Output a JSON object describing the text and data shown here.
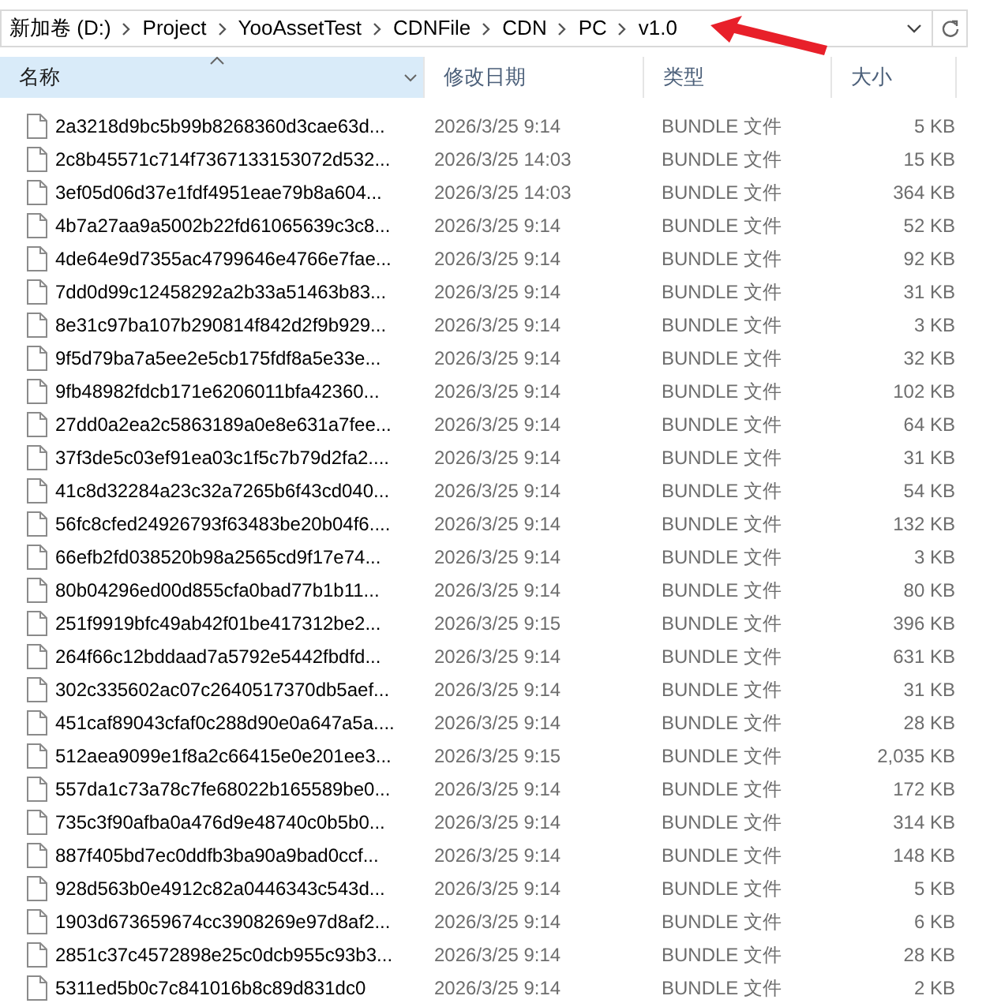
{
  "address_bar": {
    "crumbs": [
      "新加卷 (D:)",
      "Project",
      "YooAssetTest",
      "CDNFile",
      "CDN",
      "PC",
      "v1.0"
    ]
  },
  "annotation": {
    "kind": "arrow"
  },
  "columns": [
    {
      "label": "名称",
      "sorted": true
    },
    {
      "label": "修改日期",
      "sorted": false
    },
    {
      "label": "类型",
      "sorted": false
    },
    {
      "label": "大小",
      "sorted": false
    }
  ],
  "files": [
    {
      "name": "2a3218d9bc5b99b8268360d3cae63d...",
      "modified": "2026/3/25 9:14",
      "type": "BUNDLE 文件",
      "size": "5 KB"
    },
    {
      "name": "2c8b45571c714f7367133153072d532...",
      "modified": "2026/3/25 14:03",
      "type": "BUNDLE 文件",
      "size": "15 KB"
    },
    {
      "name": "3ef05d06d37e1fdf4951eae79b8a604...",
      "modified": "2026/3/25 14:03",
      "type": "BUNDLE 文件",
      "size": "364 KB"
    },
    {
      "name": "4b7a27aa9a5002b22fd61065639c3c8...",
      "modified": "2026/3/25 9:14",
      "type": "BUNDLE 文件",
      "size": "52 KB"
    },
    {
      "name": "4de64e9d7355ac4799646e4766e7fae...",
      "modified": "2026/3/25 9:14",
      "type": "BUNDLE 文件",
      "size": "92 KB"
    },
    {
      "name": "7dd0d99c12458292a2b33a51463b83...",
      "modified": "2026/3/25 9:14",
      "type": "BUNDLE 文件",
      "size": "31 KB"
    },
    {
      "name": "8e31c97ba107b290814f842d2f9b929...",
      "modified": "2026/3/25 9:14",
      "type": "BUNDLE 文件",
      "size": "3 KB"
    },
    {
      "name": "9f5d79ba7a5ee2e5cb175fdf8a5e33e...",
      "modified": "2026/3/25 9:14",
      "type": "BUNDLE 文件",
      "size": "32 KB"
    },
    {
      "name": "9fb48982fdcb171e6206011bfa42360...",
      "modified": "2026/3/25 9:14",
      "type": "BUNDLE 文件",
      "size": "102 KB"
    },
    {
      "name": "27dd0a2ea2c5863189a0e8e631a7fee...",
      "modified": "2026/3/25 9:14",
      "type": "BUNDLE 文件",
      "size": "64 KB"
    },
    {
      "name": "37f3de5c03ef91ea03c1f5c7b79d2fa2....",
      "modified": "2026/3/25 9:14",
      "type": "BUNDLE 文件",
      "size": "31 KB"
    },
    {
      "name": "41c8d32284a23c32a7265b6f43cd040...",
      "modified": "2026/3/25 9:14",
      "type": "BUNDLE 文件",
      "size": "54 KB"
    },
    {
      "name": "56fc8cfed24926793f63483be20b04f6....",
      "modified": "2026/3/25 9:14",
      "type": "BUNDLE 文件",
      "size": "132 KB"
    },
    {
      "name": "66efb2fd038520b98a2565cd9f17e74...",
      "modified": "2026/3/25 9:14",
      "type": "BUNDLE 文件",
      "size": "3 KB"
    },
    {
      "name": "80b04296ed00d855cfa0bad77b1b11...",
      "modified": "2026/3/25 9:14",
      "type": "BUNDLE 文件",
      "size": "80 KB"
    },
    {
      "name": "251f9919bfc49ab42f01be417312be2...",
      "modified": "2026/3/25 9:15",
      "type": "BUNDLE 文件",
      "size": "396 KB"
    },
    {
      "name": "264f66c12bddaad7a5792e5442fbdfd...",
      "modified": "2026/3/25 9:14",
      "type": "BUNDLE 文件",
      "size": "631 KB"
    },
    {
      "name": "302c335602ac07c2640517370db5aef...",
      "modified": "2026/3/25 9:14",
      "type": "BUNDLE 文件",
      "size": "31 KB"
    },
    {
      "name": "451caf89043cfaf0c288d90e0a647a5a....",
      "modified": "2026/3/25 9:14",
      "type": "BUNDLE 文件",
      "size": "28 KB"
    },
    {
      "name": "512aea9099e1f8a2c66415e0e201ee3...",
      "modified": "2026/3/25 9:15",
      "type": "BUNDLE 文件",
      "size": "2,035 KB"
    },
    {
      "name": "557da1c73a78c7fe68022b165589be0...",
      "modified": "2026/3/25 9:14",
      "type": "BUNDLE 文件",
      "size": "172 KB"
    },
    {
      "name": "735c3f90afba0a476d9e48740c0b5b0...",
      "modified": "2026/3/25 9:14",
      "type": "BUNDLE 文件",
      "size": "314 KB"
    },
    {
      "name": "887f405bd7ec0ddfb3ba90a9bad0ccf...",
      "modified": "2026/3/25 9:14",
      "type": "BUNDLE 文件",
      "size": "148 KB"
    },
    {
      "name": "928d563b0e4912c82a0446343c543d...",
      "modified": "2026/3/25 9:14",
      "type": "BUNDLE 文件",
      "size": "5 KB"
    },
    {
      "name": "1903d673659674cc3908269e97d8af2...",
      "modified": "2026/3/25 9:14",
      "type": "BUNDLE 文件",
      "size": "6 KB"
    },
    {
      "name": "2851c37c4572898e25c0dcb955c93b3...",
      "modified": "2026/3/25 9:14",
      "type": "BUNDLE 文件",
      "size": "28 KB"
    },
    {
      "name": "5311ed5b0c7c841016b8c89d831dc0",
      "modified": "2026/3/25 9:14",
      "type": "BUNDLE 文件",
      "size": "2 KB"
    }
  ]
}
